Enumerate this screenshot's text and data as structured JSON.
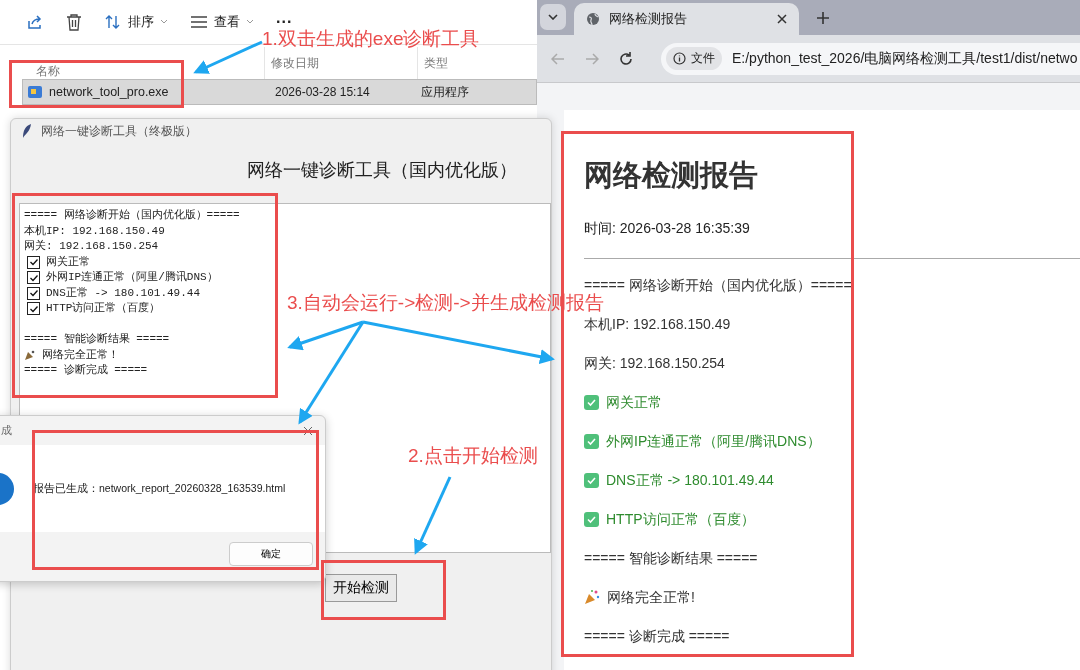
{
  "explorer": {
    "toolbar": [
      {
        "kind": "share"
      },
      {
        "kind": "delete"
      },
      {
        "kind": "sort",
        "label": "排序"
      },
      {
        "kind": "view",
        "label": "查看"
      },
      {
        "kind": "more",
        "label": "..."
      }
    ],
    "columns": [
      "名称",
      "修改日期",
      "类型"
    ],
    "files": [
      {
        "name": "network_tool_pro.exe",
        "date": "2026-03-28 15:14",
        "type": "应用程序",
        "selected": true
      }
    ]
  },
  "tool_window": {
    "title": "网络一键诊断工具（终极版）",
    "heading": "网络一键诊断工具（国内优化版）",
    "log": [
      {
        "kind": "text",
        "text": "===== 网络诊断开始（国内优化版）====="
      },
      {
        "kind": "text",
        "text": "本机IP: 192.168.150.49"
      },
      {
        "kind": "text",
        "text": "网关: 192.168.150.254"
      },
      {
        "kind": "check",
        "checked": true,
        "text": "网关正常"
      },
      {
        "kind": "check",
        "checked": true,
        "text": "外网IP连通正常（阿里/腾讯DNS）"
      },
      {
        "kind": "check",
        "checked": true,
        "text": "DNS正常 -> 180.101.49.44"
      },
      {
        "kind": "check",
        "checked": true,
        "text": "HTTP访问正常（百度）"
      },
      {
        "kind": "blank"
      },
      {
        "kind": "text",
        "text": "===== 智能诊断结果 ====="
      },
      {
        "kind": "celebrate",
        "text": "网络完全正常！"
      },
      {
        "kind": "text",
        "text": "===== 诊断完成 ====="
      }
    ],
    "button": "开始检测"
  },
  "dialog": {
    "title": "成",
    "message": "报告已生成：network_report_20260328_163539.html",
    "button": "确定"
  },
  "browser": {
    "tab": "网络检测报告",
    "address_chip": "文件",
    "address": "E:/python_test_2026/电脑网络检测工具/test1/dist/netwo",
    "report": {
      "heading": "网络检测报告",
      "time": "时间: 2026-03-28 16:35:39",
      "lines": [
        {
          "kind": "text",
          "text": "===== 网络诊断开始（国内优化版）====="
        },
        {
          "kind": "text",
          "text": "本机IP: 192.168.150.49"
        },
        {
          "kind": "text",
          "text": "网关: 192.168.150.254"
        },
        {
          "kind": "check",
          "checked": true,
          "text": "网关正常"
        },
        {
          "kind": "check",
          "checked": true,
          "text": "外网IP连通正常（阿里/腾讯DNS）"
        },
        {
          "kind": "check",
          "checked": true,
          "text": "DNS正常 -> 180.101.49.44"
        },
        {
          "kind": "check",
          "checked": true,
          "text": "HTTP访问正常（百度）"
        },
        {
          "kind": "text",
          "text": "===== 智能诊断结果 ====="
        },
        {
          "kind": "celebrate",
          "text": "网络完全正常!"
        },
        {
          "kind": "text",
          "text": "===== 诊断完成 ====="
        }
      ]
    }
  },
  "annotations": [
    "1.双击生成的exe诊断工具",
    "3.自动会运行->检测->并生成检测报告",
    "2.点击开始检测"
  ]
}
